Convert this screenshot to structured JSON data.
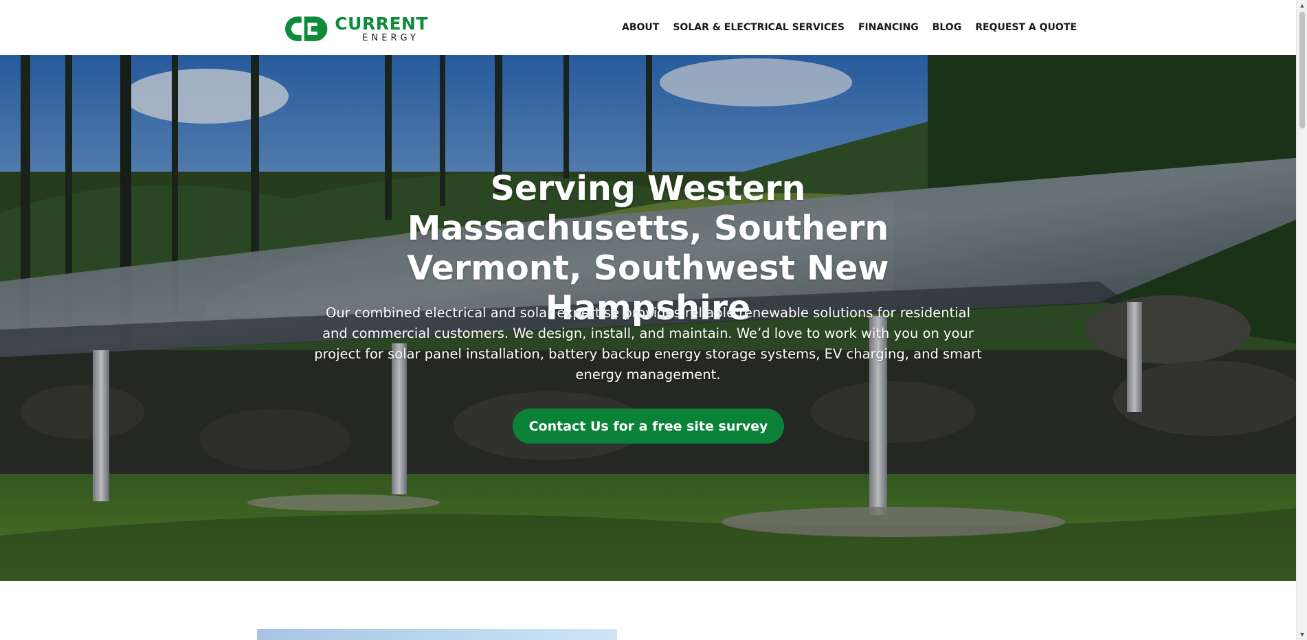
{
  "brand": {
    "name": "CURRENT",
    "subname": "ENERGY",
    "logo_icon": "plug-logo-icon",
    "accent_color": "#0a8237"
  },
  "nav": {
    "items": [
      {
        "label": "ABOUT"
      },
      {
        "label": "SOLAR & ELECTRICAL SERVICES"
      },
      {
        "label": "FINANCING"
      },
      {
        "label": "BLOG"
      },
      {
        "label": "REQUEST A QUOTE"
      }
    ]
  },
  "hero": {
    "title": "Serving Western Massachusetts, Southern Vermont, Southwest New Hampshire",
    "description": "Our combined electrical and solar expertise provides reliable renewable solutions for residential and commercial customers. We design, install, and maintain. We’d love to work with you on your project for solar panel installation, battery backup energy storage systems, EV charging, and smart energy management.",
    "cta_label": "Contact Us for a free site survey"
  },
  "scrollbar": {
    "up_icon": "scroll-up-arrow-icon",
    "down_icon": "scroll-down-arrow-icon"
  }
}
